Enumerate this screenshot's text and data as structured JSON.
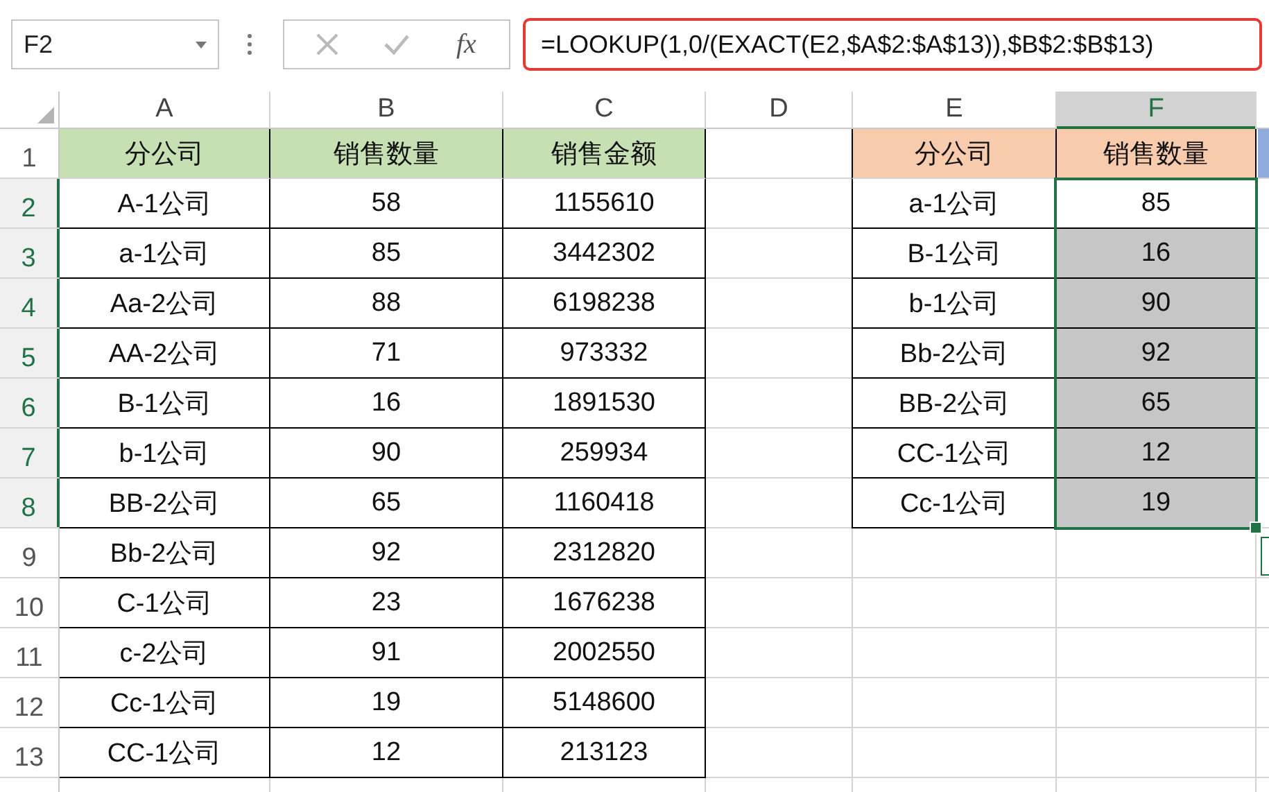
{
  "name_box": {
    "value": "F2"
  },
  "formula_bar": {
    "function_label": "fx",
    "formula": "=LOOKUP(1,0/(EXACT(E2,$A$2:$A$13)),$B$2:$B$13)"
  },
  "columns": [
    {
      "label": "A",
      "selected": false
    },
    {
      "label": "B",
      "selected": false
    },
    {
      "label": "C",
      "selected": false
    },
    {
      "label": "D",
      "selected": false
    },
    {
      "label": "E",
      "selected": false
    },
    {
      "label": "F",
      "selected": true
    }
  ],
  "row_headers": [
    {
      "label": "1",
      "selected": false
    },
    {
      "label": "2",
      "selected": true
    },
    {
      "label": "3",
      "selected": true
    },
    {
      "label": "4",
      "selected": true
    },
    {
      "label": "5",
      "selected": true
    },
    {
      "label": "6",
      "selected": true
    },
    {
      "label": "7",
      "selected": true
    },
    {
      "label": "8",
      "selected": true
    },
    {
      "label": "9",
      "selected": false
    },
    {
      "label": "10",
      "selected": false
    },
    {
      "label": "11",
      "selected": false
    },
    {
      "label": "12",
      "selected": false
    },
    {
      "label": "13",
      "selected": false
    }
  ],
  "left_table": {
    "header": [
      {
        "text": "分公司",
        "color": "#c6e0b4"
      },
      {
        "text": "销售数量",
        "color": "#c6e0b4"
      },
      {
        "text": "销售金额",
        "color": "#c6e0b4"
      }
    ],
    "rows": [
      [
        "A-1公司",
        "58",
        "1155610"
      ],
      [
        "a-1公司",
        "85",
        "3442302"
      ],
      [
        "Aa-2公司",
        "88",
        "6198238"
      ],
      [
        "AA-2公司",
        "71",
        "973332"
      ],
      [
        "B-1公司",
        "16",
        "1891530"
      ],
      [
        "b-1公司",
        "90",
        "259934"
      ],
      [
        "BB-2公司",
        "65",
        "1160418"
      ],
      [
        "Bb-2公司",
        "92",
        "2312820"
      ],
      [
        "C-1公司",
        "23",
        "1676238"
      ],
      [
        "c-2公司",
        "91",
        "2002550"
      ],
      [
        "Cc-1公司",
        "19",
        "5148600"
      ],
      [
        "CC-1公司",
        "12",
        "213123"
      ]
    ]
  },
  "right_table": {
    "header": [
      {
        "text": "分公司",
        "color": "#f8cbad"
      },
      {
        "text": "销售数量",
        "color": "#f8cbad"
      }
    ],
    "rows": [
      {
        "cells": [
          "a-1公司",
          "85"
        ],
        "selected": true,
        "active": true
      },
      {
        "cells": [
          "B-1公司",
          "16"
        ],
        "selected": true,
        "active": false
      },
      {
        "cells": [
          "b-1公司",
          "90"
        ],
        "selected": true,
        "active": false
      },
      {
        "cells": [
          "Bb-2公司",
          "92"
        ],
        "selected": true,
        "active": false
      },
      {
        "cells": [
          "BB-2公司",
          "65"
        ],
        "selected": true,
        "active": false
      },
      {
        "cells": [
          "CC-1公司",
          "12"
        ],
        "selected": true,
        "active": false
      },
      {
        "cells": [
          "Cc-1公司",
          "19"
        ],
        "selected": true,
        "active": false
      }
    ]
  }
}
